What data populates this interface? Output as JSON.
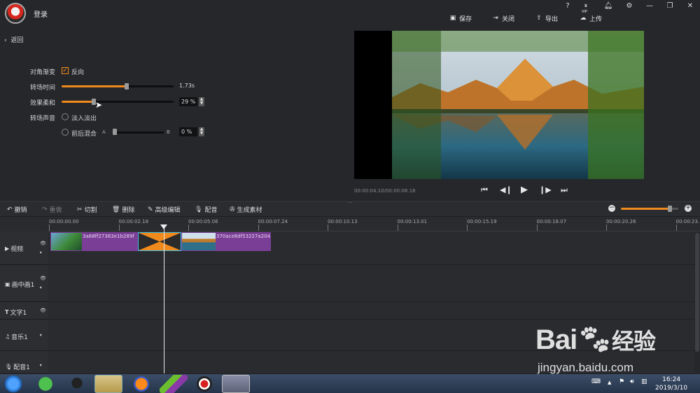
{
  "header": {
    "login": "登录",
    "toolbar": {
      "save": "保存",
      "close": "关闭",
      "export": "导出",
      "upload": "上传"
    },
    "vip": "VIP",
    "help": "?"
  },
  "panel": {
    "back": "返回",
    "diagonal_label": "对角渐变",
    "reverse_label": "反向",
    "reverse_checked": true,
    "duration_label": "转场时间",
    "duration_value": "1.73s",
    "duration_fraction": 0.58,
    "softness_label": "效果柔和",
    "softness_value": "29 %",
    "softness_fraction": 0.29,
    "sound_label": "转场声音",
    "fade_label": "淡入淡出",
    "mix_label": "前后混合",
    "mix_a": "A",
    "mix_b": "B",
    "mix_value": "0 %",
    "mix_fraction": 0.0
  },
  "preview": {
    "timecode": "00:00:04.10/00:00:08.18"
  },
  "edit_toolbar": {
    "undo": "撤销",
    "redo": "重做",
    "cut": "切割",
    "delete": "删除",
    "advanced": "高级编辑",
    "dub": "配音",
    "material": "生成素材",
    "zoom_fraction": 0.85
  },
  "ruler": {
    "ticks": [
      "00:00:00.00",
      "00:00:02.18",
      "00:00:05.06",
      "00:00:07.24",
      "00:00:10.13",
      "00:00:13.01",
      "00:00:15.19",
      "00:00:18.07",
      "00:00:20.26",
      "00:00:23."
    ]
  },
  "tracks": {
    "video": "视频",
    "pip": "画中画1",
    "text": "文字1",
    "music": "音乐1",
    "voice": "配音1",
    "clip1_name": "3a68ff27363e1b289f",
    "clip2_name": "370ace8df53227a204"
  },
  "taskbar": {
    "time": "16:24",
    "date": "2019/3/10"
  },
  "watermark": {
    "brand": "Bai",
    "brand2": "经验",
    "url": "jingyan.baidu.com"
  },
  "colors": {
    "accent": "#f08a1c",
    "clip": "#7a3e96"
  }
}
